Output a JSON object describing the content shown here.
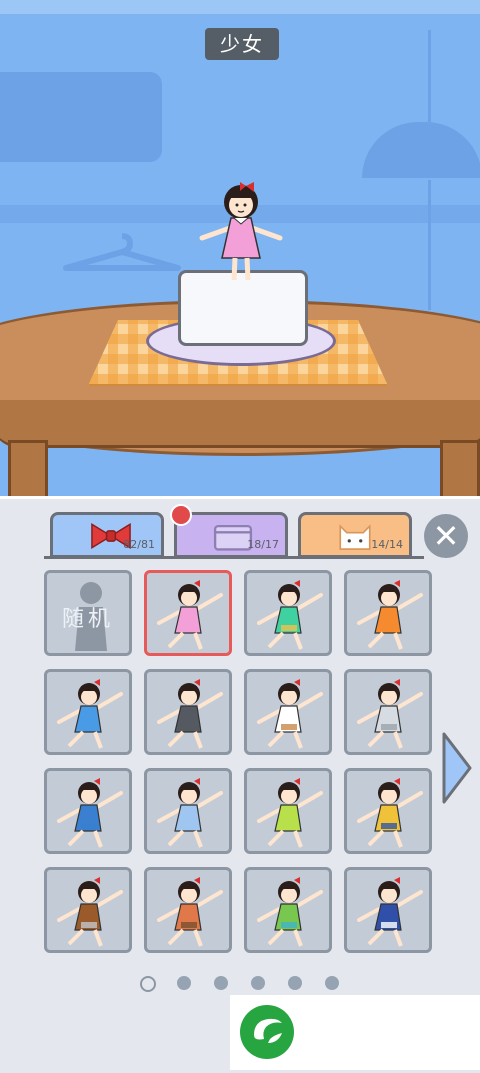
{
  "header": {
    "title": "少女"
  },
  "tabs": [
    {
      "name": "bow",
      "count": "82/81"
    },
    {
      "name": "box",
      "count": "18/17"
    },
    {
      "name": "cat",
      "count": "14/14"
    }
  ],
  "grid": {
    "random_label": "随机",
    "outfits": [
      {
        "dress": "#f3a0d8",
        "accent": "#f3a0d8"
      },
      {
        "dress": "#3fd1a0",
        "accent": "#f2c14a"
      },
      {
        "dress": "#f58b2e",
        "accent": "#f58b2e"
      },
      {
        "dress": "#4a9be6",
        "accent": "#4a9be6"
      },
      {
        "dress": "#555a62",
        "accent": "#555a62"
      },
      {
        "dress": "#ffffff",
        "accent": "#c88a4a"
      },
      {
        "dress": "#d7dbe2",
        "accent": "#9aa2ad"
      },
      {
        "dress": "#3a7fd0",
        "accent": "#3a7fd0"
      },
      {
        "dress": "#9ec6f0",
        "accent": "#9ec6f0"
      },
      {
        "dress": "#b8e04a",
        "accent": "#b8e04a"
      },
      {
        "dress": "#f0c23a",
        "accent": "#2f58a8"
      },
      {
        "dress": "#9a5a2a",
        "accent": "#c0c4cc"
      },
      {
        "dress": "#e0784a",
        "accent": "#7a5030"
      },
      {
        "dress": "#78c850",
        "accent": "#3fb3c8"
      },
      {
        "dress": "#2f4fa8",
        "accent": "#ffffff"
      }
    ]
  },
  "pagination": {
    "pages": 6,
    "current": 1
  },
  "colors": {
    "sky": "#7fb4f2",
    "panel": "#e4e8ee",
    "selected_border": "#e65a5a"
  }
}
